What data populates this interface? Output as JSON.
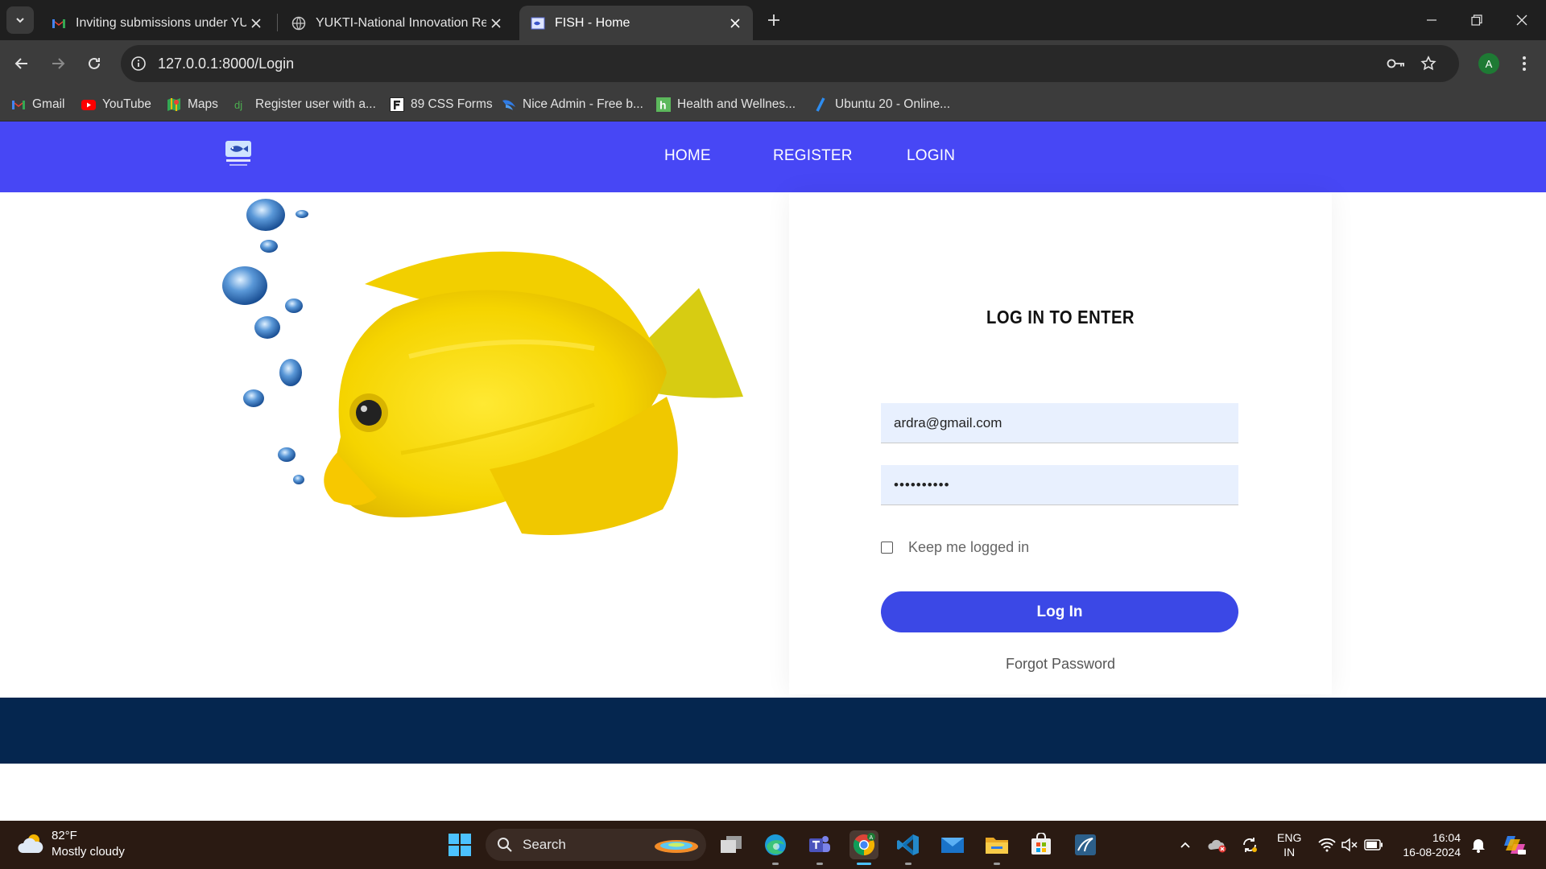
{
  "browser": {
    "tabs": [
      {
        "title": "Inviting submissions under YUK",
        "icon": "gmail-icon",
        "active": false
      },
      {
        "title": "YUKTI-National Innovation Rep",
        "icon": "globe-icon",
        "active": false
      },
      {
        "title": "FISH - Home",
        "icon": "site-favicon",
        "active": true
      }
    ],
    "url": "127.0.0.1:8000/Login",
    "profile_initial": "A",
    "bookmarks": [
      {
        "label": "Gmail",
        "icon": "gmail-icon"
      },
      {
        "label": "YouTube",
        "icon": "youtube-icon"
      },
      {
        "label": "Maps",
        "icon": "maps-icon"
      },
      {
        "label": "Register user with a...",
        "icon": "bookmark-icon"
      },
      {
        "label": "89 CSS Forms",
        "icon": "f-icon"
      },
      {
        "label": "Nice Admin - Free b...",
        "icon": "niceadmin-icon"
      },
      {
        "label": "Health and Wellnes...",
        "icon": "h-icon"
      },
      {
        "label": "Ubuntu 20 - Online...",
        "icon": "slash-icon"
      }
    ]
  },
  "site": {
    "nav": {
      "home": "HOME",
      "register": "REGISTER",
      "login": "LOGIN"
    },
    "login": {
      "title": "LOG IN TO ENTER",
      "email_value": "ardra@gmail.com",
      "password_value": "••••••••••",
      "remember_label": "Keep me logged in",
      "submit_label": "Log In",
      "forgot_label": "Forgot Password"
    },
    "colors": {
      "nav_bg": "#4747f5",
      "button": "#3b48e6",
      "footer": "#05264f",
      "field_bg": "#e8f0fe"
    }
  },
  "taskbar": {
    "weather_temp": "82°F",
    "weather_desc": "Mostly cloudy",
    "search_label": "Search",
    "lang_line1": "ENG",
    "lang_line2": "IN",
    "time": "16:04",
    "date": "16-08-2024"
  }
}
